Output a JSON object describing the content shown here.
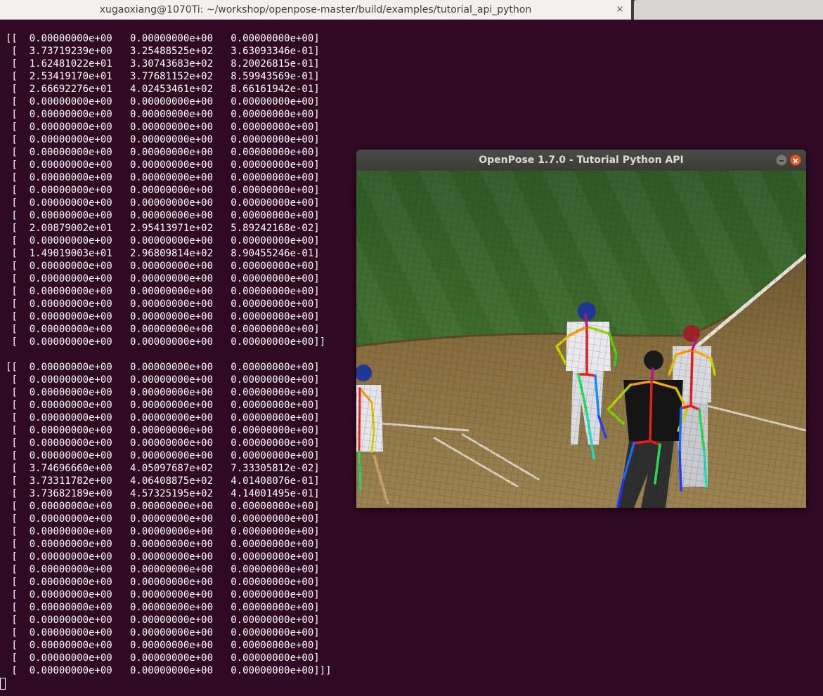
{
  "terminal": {
    "tab_title": "xugaoxiang@1070Ti: ~/workshop/openpose-master/build/examples/tutorial_api_python",
    "close_glyph": "×",
    "block1": [
      "[[  0.00000000e+00   0.00000000e+00   0.00000000e+00]",
      " [  3.73719239e+00   3.25488525e+02   3.63093346e-01]",
      " [  1.62481022e+01   3.30743683e+02   8.20026815e-01]",
      " [  2.53419170e+01   3.77681152e+02   8.59943569e-01]",
      " [  2.66692276e+01   4.02453461e+02   8.66161942e-01]",
      " [  0.00000000e+00   0.00000000e+00   0.00000000e+00]",
      " [  0.00000000e+00   0.00000000e+00   0.00000000e+00]",
      " [  0.00000000e+00   0.00000000e+00   0.00000000e+00]",
      " [  0.00000000e+00   0.00000000e+00   0.00000000e+00]",
      " [  0.00000000e+00   0.00000000e+00   0.00000000e+00]",
      " [  0.00000000e+00   0.00000000e+00   0.00000000e+00]",
      " [  0.00000000e+00   0.00000000e+00   0.00000000e+00]",
      " [  0.00000000e+00   0.00000000e+00   0.00000000e+00]",
      " [  0.00000000e+00   0.00000000e+00   0.00000000e+00]",
      " [  0.00000000e+00   0.00000000e+00   0.00000000e+00]",
      " [  2.00879002e+01   2.95413971e+02   5.89242168e-02]",
      " [  0.00000000e+00   0.00000000e+00   0.00000000e+00]",
      " [  1.49019003e+01   2.96809814e+02   8.90455246e-01]",
      " [  0.00000000e+00   0.00000000e+00   0.00000000e+00]",
      " [  0.00000000e+00   0.00000000e+00   0.00000000e+00]",
      " [  0.00000000e+00   0.00000000e+00   0.00000000e+00]",
      " [  0.00000000e+00   0.00000000e+00   0.00000000e+00]",
      " [  0.00000000e+00   0.00000000e+00   0.00000000e+00]",
      " [  0.00000000e+00   0.00000000e+00   0.00000000e+00]",
      " [  0.00000000e+00   0.00000000e+00   0.00000000e+00]]"
    ],
    "block2": [
      "[[  0.00000000e+00   0.00000000e+00   0.00000000e+00]",
      " [  0.00000000e+00   0.00000000e+00   0.00000000e+00]",
      " [  0.00000000e+00   0.00000000e+00   0.00000000e+00]",
      " [  0.00000000e+00   0.00000000e+00   0.00000000e+00]",
      " [  0.00000000e+00   0.00000000e+00   0.00000000e+00]",
      " [  0.00000000e+00   0.00000000e+00   0.00000000e+00]",
      " [  0.00000000e+00   0.00000000e+00   0.00000000e+00]",
      " [  0.00000000e+00   0.00000000e+00   0.00000000e+00]",
      " [  3.74696660e+00   4.05097687e+02   7.33305812e-02]",
      " [  3.73311782e+00   4.06408875e+02   4.01408076e-01]",
      " [  3.73682189e+00   4.57325195e+02   4.14001495e-01]",
      " [  0.00000000e+00   0.00000000e+00   0.00000000e+00]",
      " [  0.00000000e+00   0.00000000e+00   0.00000000e+00]",
      " [  0.00000000e+00   0.00000000e+00   0.00000000e+00]",
      " [  0.00000000e+00   0.00000000e+00   0.00000000e+00]",
      " [  0.00000000e+00   0.00000000e+00   0.00000000e+00]",
      " [  0.00000000e+00   0.00000000e+00   0.00000000e+00]",
      " [  0.00000000e+00   0.00000000e+00   0.00000000e+00]",
      " [  0.00000000e+00   0.00000000e+00   0.00000000e+00]",
      " [  0.00000000e+00   0.00000000e+00   0.00000000e+00]",
      " [  0.00000000e+00   0.00000000e+00   0.00000000e+00]",
      " [  0.00000000e+00   0.00000000e+00   0.00000000e+00]",
      " [  0.00000000e+00   0.00000000e+00   0.00000000e+00]",
      " [  0.00000000e+00   0.00000000e+00   0.00000000e+00]",
      " [  0.00000000e+00   0.00000000e+00   0.00000000e+00]]]"
    ]
  },
  "window": {
    "title": "OpenPose 1.7.0 - Tutorial Python API",
    "image_subject": "baseball home plate scene with pose skeleton overlays"
  },
  "colors": {
    "terminal_bg": "#300a24",
    "terminal_text": "#ffffff",
    "close_button": "#e95420"
  }
}
